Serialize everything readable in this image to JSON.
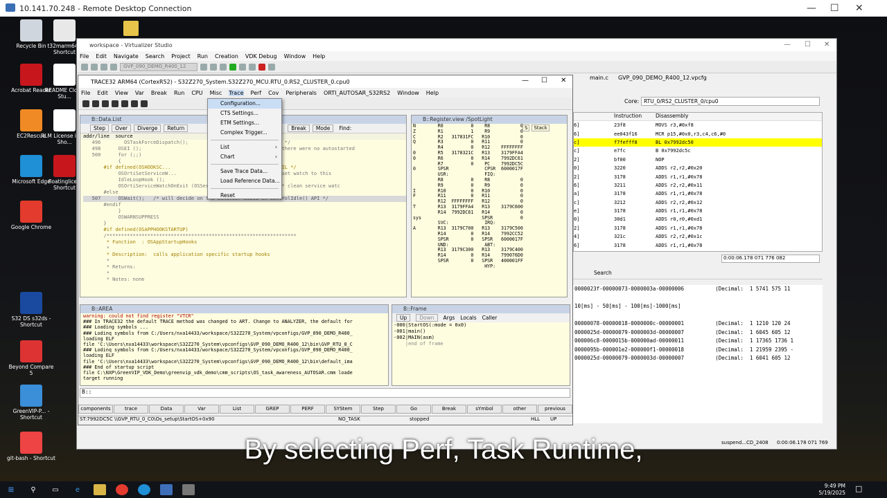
{
  "rdp": {
    "title": "10.141.70.248 - Remote Desktop Connection"
  },
  "desktop_icons": [
    {
      "label": "Recycle Bin",
      "color": "#cfd6de"
    },
    {
      "label": "t32marm64 - Shortcut",
      "color": "#e8e8e8"
    },
    {
      "label": "Acrobat Reader",
      "color": "#c8161d"
    },
    {
      "label": "README Cloud Stu...",
      "color": "#ffffff"
    },
    {
      "label": "EC2Rescue",
      "color": "#f08a24"
    },
    {
      "label": "RLM License info - Sho...",
      "color": "#ffffff"
    },
    {
      "label": "Microsoft Edge",
      "color": "#1f8fd6"
    },
    {
      "label": "floatinglice - Shortcut",
      "color": "#c8161d"
    },
    {
      "label": "Google Chrome",
      "color": "#e33b2e"
    },
    {
      "label": "S32 DS s32ds - Shortcut",
      "color": "#1a4aa0"
    },
    {
      "label": "Beyond Compare 5",
      "color": "#d33"
    },
    {
      "label": "GreenVIP-P... - Shortcut",
      "color": "#3b8ed8"
    },
    {
      "label": "git-bash - Shortcut",
      "color": "#e44"
    }
  ],
  "virtualizer": {
    "title": "workspace - Virtualizer Studio",
    "menu": [
      "File",
      "Edit",
      "Navigate",
      "Search",
      "Project",
      "Run",
      "Creation",
      "VDK Debug",
      "Window",
      "Help"
    ],
    "config_select": "GVP_090_DEMO_R400_12",
    "tabs": [
      "main.c",
      "GVP_090_DEMO_R400_12.vpcfg"
    ],
    "core_label": "Core:",
    "core_value": "RTU_0/RS2_CLUSTER_0/cpu0",
    "disasm_headers": [
      "Instruction",
      "Disassembly"
    ],
    "disasm_rows": [
      {
        "idx": "6]",
        "ins": "23f8",
        "asm": "MOVS      r3,#0xf8"
      },
      {
        "idx": "6]",
        "ins": "ee043f16",
        "asm": "MCR       p15,#0x0,r3,c4,c6,#0"
      },
      {
        "idx": "c]",
        "ins": "f7fefff8",
        "asm": "BL        0x7992dc50"
      },
      {
        "idx": "c]",
        "ins": "e7fc",
        "asm": "B         0x7992dc5c"
      },
      {
        "idx": "2]",
        "ins": "bf00",
        "asm": "NOP"
      },
      {
        "idx": "0]",
        "ins": "3220",
        "asm": "ADDS      r2,r2,#0x20"
      },
      {
        "idx": "2]",
        "ins": "3178",
        "asm": "ADDS      r1,r1,#0x78"
      },
      {
        "idx": "6]",
        "ins": "3211",
        "asm": "ADDS      r2,r2,#0x11"
      },
      {
        "idx": "a]",
        "ins": "3178",
        "asm": "ADDS      r1,r1,#0x78"
      },
      {
        "idx": "c]",
        "ins": "3212",
        "asm": "ADDS      r2,r2,#0x12"
      },
      {
        "idx": "e]",
        "ins": "3178",
        "asm": "ADDS      r1,r1,#0x78"
      },
      {
        "idx": "0]",
        "ins": "30d1",
        "asm": "ADDS      r0,r0,#0xd1"
      },
      {
        "idx": "2]",
        "ins": "3178",
        "asm": "ADDS      r1,r1,#0x78"
      },
      {
        "idx": "4]",
        "ins": "321c",
        "asm": "ADDS      r2,r2,#0x1c"
      },
      {
        "idx": "6]",
        "ins": "3178",
        "asm": "ADDS      r1,r1,#0x78"
      }
    ],
    "time_value": "0:00:06.178 071 776 082",
    "search_tab": "Search",
    "console_lines": [
      "0000023f-00000073-0000003a-00000006          (Decimal:  1 5741 575 11",
      "",
      "10[ms] - 50[ms] - 100[ms]-1000[ms]",
      "",
      "00000078-00000018-0000000c-00000001          (Decimal:  1 1210 120 24",
      "0000025d-00000079-0000003d-00000007          (Decimal:  1 6045 605 12",
      "000006c8-0000015b-000000ad-00000011          (Decimal:  1 17365 1736 1",
      "0000095b-000001e2-000000f1-00000018          (Decimal:  1 21959 2395 -",
      "0000025d-00000079-0000003d-00000007          (Decimal:  1 6041 605 12"
    ],
    "status_right": "suspend...CD_2408",
    "status_time": "0:00:06.178 071 769"
  },
  "trace32": {
    "title": "TRACE32 ARM64 (CortexR52) - S32Z270_System.S32Z270_MCU.RTU_0.RS2_CLUSTER_0.cpu0",
    "menu": [
      "File",
      "Edit",
      "View",
      "Var",
      "Break",
      "Run",
      "CPU",
      "Misc",
      "Trace",
      "Perf",
      "Cov",
      "Peripherals",
      "ORTI_AUTOSAR_S32RS2",
      "Window",
      "Help"
    ],
    "data_list": {
      "title": "B::Data.List",
      "buttons": [
        "Step",
        "Over",
        "Diverge",
        "Return"
      ],
      "right_buttons": [
        "Break",
        "Mode",
        "Find:"
      ],
      "header": "addr/line  source",
      "lines": [
        "   496        OSTaskForceDispatch();                     ated Tasks  */",
        "   498      OSEI ();                                     ization if there were no autostarted",
        "   500      for (;;)",
        "            {",
        "       #if defined(OSHOOKSC...                           urable by OIL */",
        "            OSOrtiSetServiceW...              IdleLoopHook);     /* set watch to this",
        "            IdleLoopHook ();",
        "            OSOrtiServiceWatchOnExit (OSServiceId_IdleLoopHook);   /* clean service watc",
        "       #else",
        "   507      OSWait();   /* will decide on the behavior based on ControlIdle() API */",
        "       #endif",
        "            }",
        "",
        "            OSWARNSUPPRESS",
        "       }",
        "       #if defined(OSAPPHOOKSTARTUP)",
        "       /*****************************************************************",
        "        * Function  : OSAppStartupHooks",
        "        *",
        "        * Description:  calls application specific startup hooks",
        "        *",
        "        * Returns:",
        "        *",
        "        * Notes: none"
      ]
    },
    "trace_menu": {
      "items": [
        "Configuration...",
        "CTS Settings...",
        "ETM Settings...",
        "Complex Trigger...",
        "List",
        "Chart",
        "Save Trace Data...",
        "Load Reference Data...",
        "Reset"
      ]
    },
    "register": {
      "title": "B::Register.view /SpotLight",
      "buttons": [
        "S",
        "Stack"
      ],
      "lines": [
        "N        R0          0    R8           0",
        "Z        R1          1    R9           0",
        "C        R2   317831FC   R10           0",
        "Q        R3          0   R11           0",
        "         R4          0   R12    FFFFFFFF",
        "0        R5   3178321C   R13    3179FFA4",
        "0        R6          0   R14    7992DC61",
        "         R7          0    PC    7992DC5C",
        "0        SPSR             CPSR  6000017F",
        "",
        "         USR:             FIQ:",
        "         R8          0    R8           0",
        "         R9          0    R9           0",
        "I        R10         0   R10           0",
        "F        R11         0   R11           0",
        "         R12  FFFFFFFF   R12           0",
        "T        R13  3179FFA4   R13    3179C600",
        "         R14  7992DC61   R14           0",
        "sys                      SPSR          0",
        "",
        "         SVC:             IRQ:",
        "A        R13  3179C700   R13    3179C500",
        "         R14         0   R14    7992CC52",
        "         SPSR        0   SPSR   6000017F",
        "",
        "         UND:             ABT:",
        "         R13  3179C300   R13    3179C400",
        "         R14         0   R14    799076D0",
        "         SPSR        0   SPSR   400001FF",
        "",
        "                          HYP:"
      ]
    },
    "area": {
      "title": "B::AREA",
      "lines": [
        "warning: could not find register \"VTCR\"",
        "### In TRACE32 the default TRACE method was changed to ART. Change to ANALYZER, the default for",
        "### Loading symbols ...",
        "### Lodinq symbols from C:/Users/nxa14433/workspace/S32Z270_System/vpconfigs/GVP_090_DEMO_R400_",
        "loading ELF",
        "file 'C:\\Users\\nxa14433\\workspace\\S32Z270_System\\vpconfigs\\GVP_090_DEMO_R400_12\\bin\\GVP_RTU_0_C",
        "### Lodinq symbols from C:/Users/nxa14433/workspace/S32Z270_System/vpconfigs/GVP_090_DEMO_R400_",
        "loading ELF",
        "file 'C:\\Users\\nxa14433\\workspace\\S32Z270_System\\vpconfigs\\GVP_090_DEMO_R400_12\\bin\\default_ima",
        "### End of startup script",
        "file C:\\NXP\\GreenVIP_VDK_Demo\\greenvip_vdk_demo\\cmm_scripts\\OS_task_awareness_AUTOSAR.cmm loade",
        "target running"
      ]
    },
    "frame": {
      "title": "B::Frame",
      "buttons": [
        "Up",
        "Down",
        "Args",
        "Locals",
        "Caller"
      ],
      "lines": [
        "-000|StartOS(:mode = 0x0)",
        "-001|main()",
        "-002|MAIN(asm)",
        "    |end of frame"
      ]
    },
    "command_prompt": "B::",
    "softkeys": [
      "components",
      "trace",
      "Data",
      "Var",
      "List",
      "GREP",
      "PERF",
      "SYStem",
      "Step",
      "Go",
      "Break",
      "sYmbol",
      "other",
      "previous"
    ],
    "status": {
      "location": "ST:7992DC5C \\\\GVP_RTU_0_C0\\Os_setup\\StartOS+0x90",
      "task": "NO_TASK",
      "state": "stopped",
      "mode": "HLL",
      "up": "UP"
    }
  },
  "subtitle": "By selecting Perf, Task Runtime,",
  "clock": {
    "time": "9:49 PM",
    "date": "5/19/2025"
  }
}
